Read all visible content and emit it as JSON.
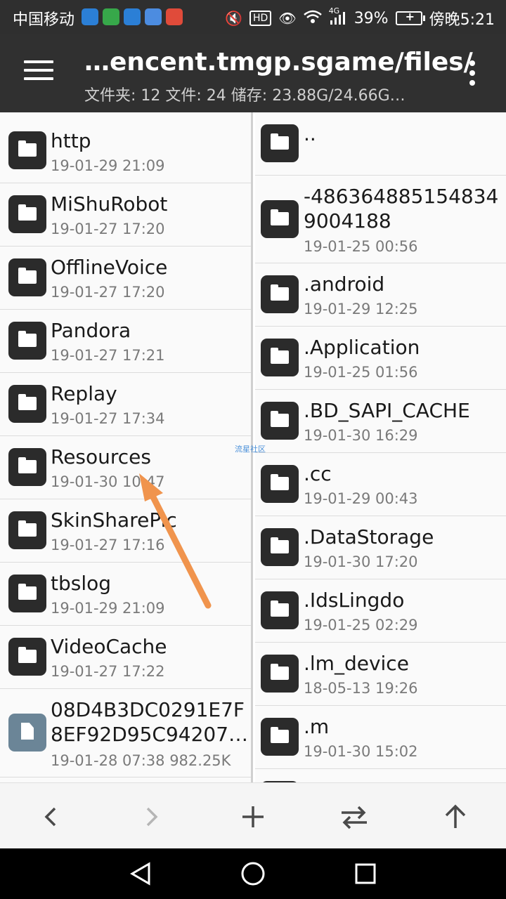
{
  "status_bar": {
    "carrier": "中国移动",
    "signal_badge": "4G",
    "battery": "39%",
    "time": "傍晚5:21",
    "hd_label": "HD"
  },
  "toolbar": {
    "title": "…encent.tmgp.sgame/files/",
    "subtitle": "文件夹: 12  文件: 24  储存: 23.88G/24.66G…"
  },
  "left_pane": {
    "items": [
      {
        "name": "http",
        "meta": "19-01-29 21:09",
        "type": "folder"
      },
      {
        "name": "MiShuRobot",
        "meta": "19-01-27 17:20",
        "type": "folder"
      },
      {
        "name": "OfflineVoice",
        "meta": "19-01-27 17:20",
        "type": "folder"
      },
      {
        "name": "Pandora",
        "meta": "19-01-27 17:21",
        "type": "folder"
      },
      {
        "name": "Replay",
        "meta": "19-01-27 17:34",
        "type": "folder"
      },
      {
        "name": "Resources",
        "meta": "19-01-30 10:47",
        "type": "folder"
      },
      {
        "name": "SkinSharePic",
        "meta": "19-01-27 17:16",
        "type": "folder"
      },
      {
        "name": "tbslog",
        "meta": "19-01-29 21:09",
        "type": "folder"
      },
      {
        "name": "VideoCache",
        "meta": "19-01-27 17:22",
        "type": "folder"
      },
      {
        "name_line1": "08D4B3DC0291E7F",
        "name_line2": "8EF92D95C94207…",
        "meta": "19-01-28 07:38  982.25K",
        "type": "file"
      }
    ]
  },
  "right_pane": {
    "items": [
      {
        "name": "..",
        "meta": "",
        "type": "folder"
      },
      {
        "name_line1": "-486364885154834",
        "name_line2": "9004188",
        "meta": "19-01-25 00:56",
        "type": "folder"
      },
      {
        "name": ".android",
        "meta": "19-01-29 12:25",
        "type": "folder"
      },
      {
        "name": ".Application",
        "meta": "19-01-25 01:56",
        "type": "folder"
      },
      {
        "name": ".BD_SAPI_CACHE",
        "meta": "19-01-30 16:29",
        "type": "folder"
      },
      {
        "name": ".cc",
        "meta": "19-01-29 00:43",
        "type": "folder"
      },
      {
        "name": ".DataStorage",
        "meta": "19-01-30 17:20",
        "type": "folder"
      },
      {
        "name": ".IdsLingdo",
        "meta": "19-01-25 02:29",
        "type": "folder"
      },
      {
        "name": ".lm_device",
        "meta": "18-05-13 19:26",
        "type": "folder"
      },
      {
        "name": ".m",
        "meta": "19-01-30 15:02",
        "type": "folder"
      }
    ]
  },
  "watermark": "流星社区",
  "action_bar": {
    "icons": [
      "chevron-left-icon",
      "chevron-right-icon",
      "plus-icon",
      "swap-icon",
      "arrow-up-icon"
    ]
  },
  "nav_bar": {
    "icons": [
      "back-triangle-icon",
      "home-circle-icon",
      "recents-square-icon"
    ]
  },
  "colors": {
    "toolbar_bg": "#303030",
    "folder_icon_bg": "#2b2b2b",
    "file_icon_bg": "#6b8597",
    "annotation_arrow": "#f0944d"
  }
}
